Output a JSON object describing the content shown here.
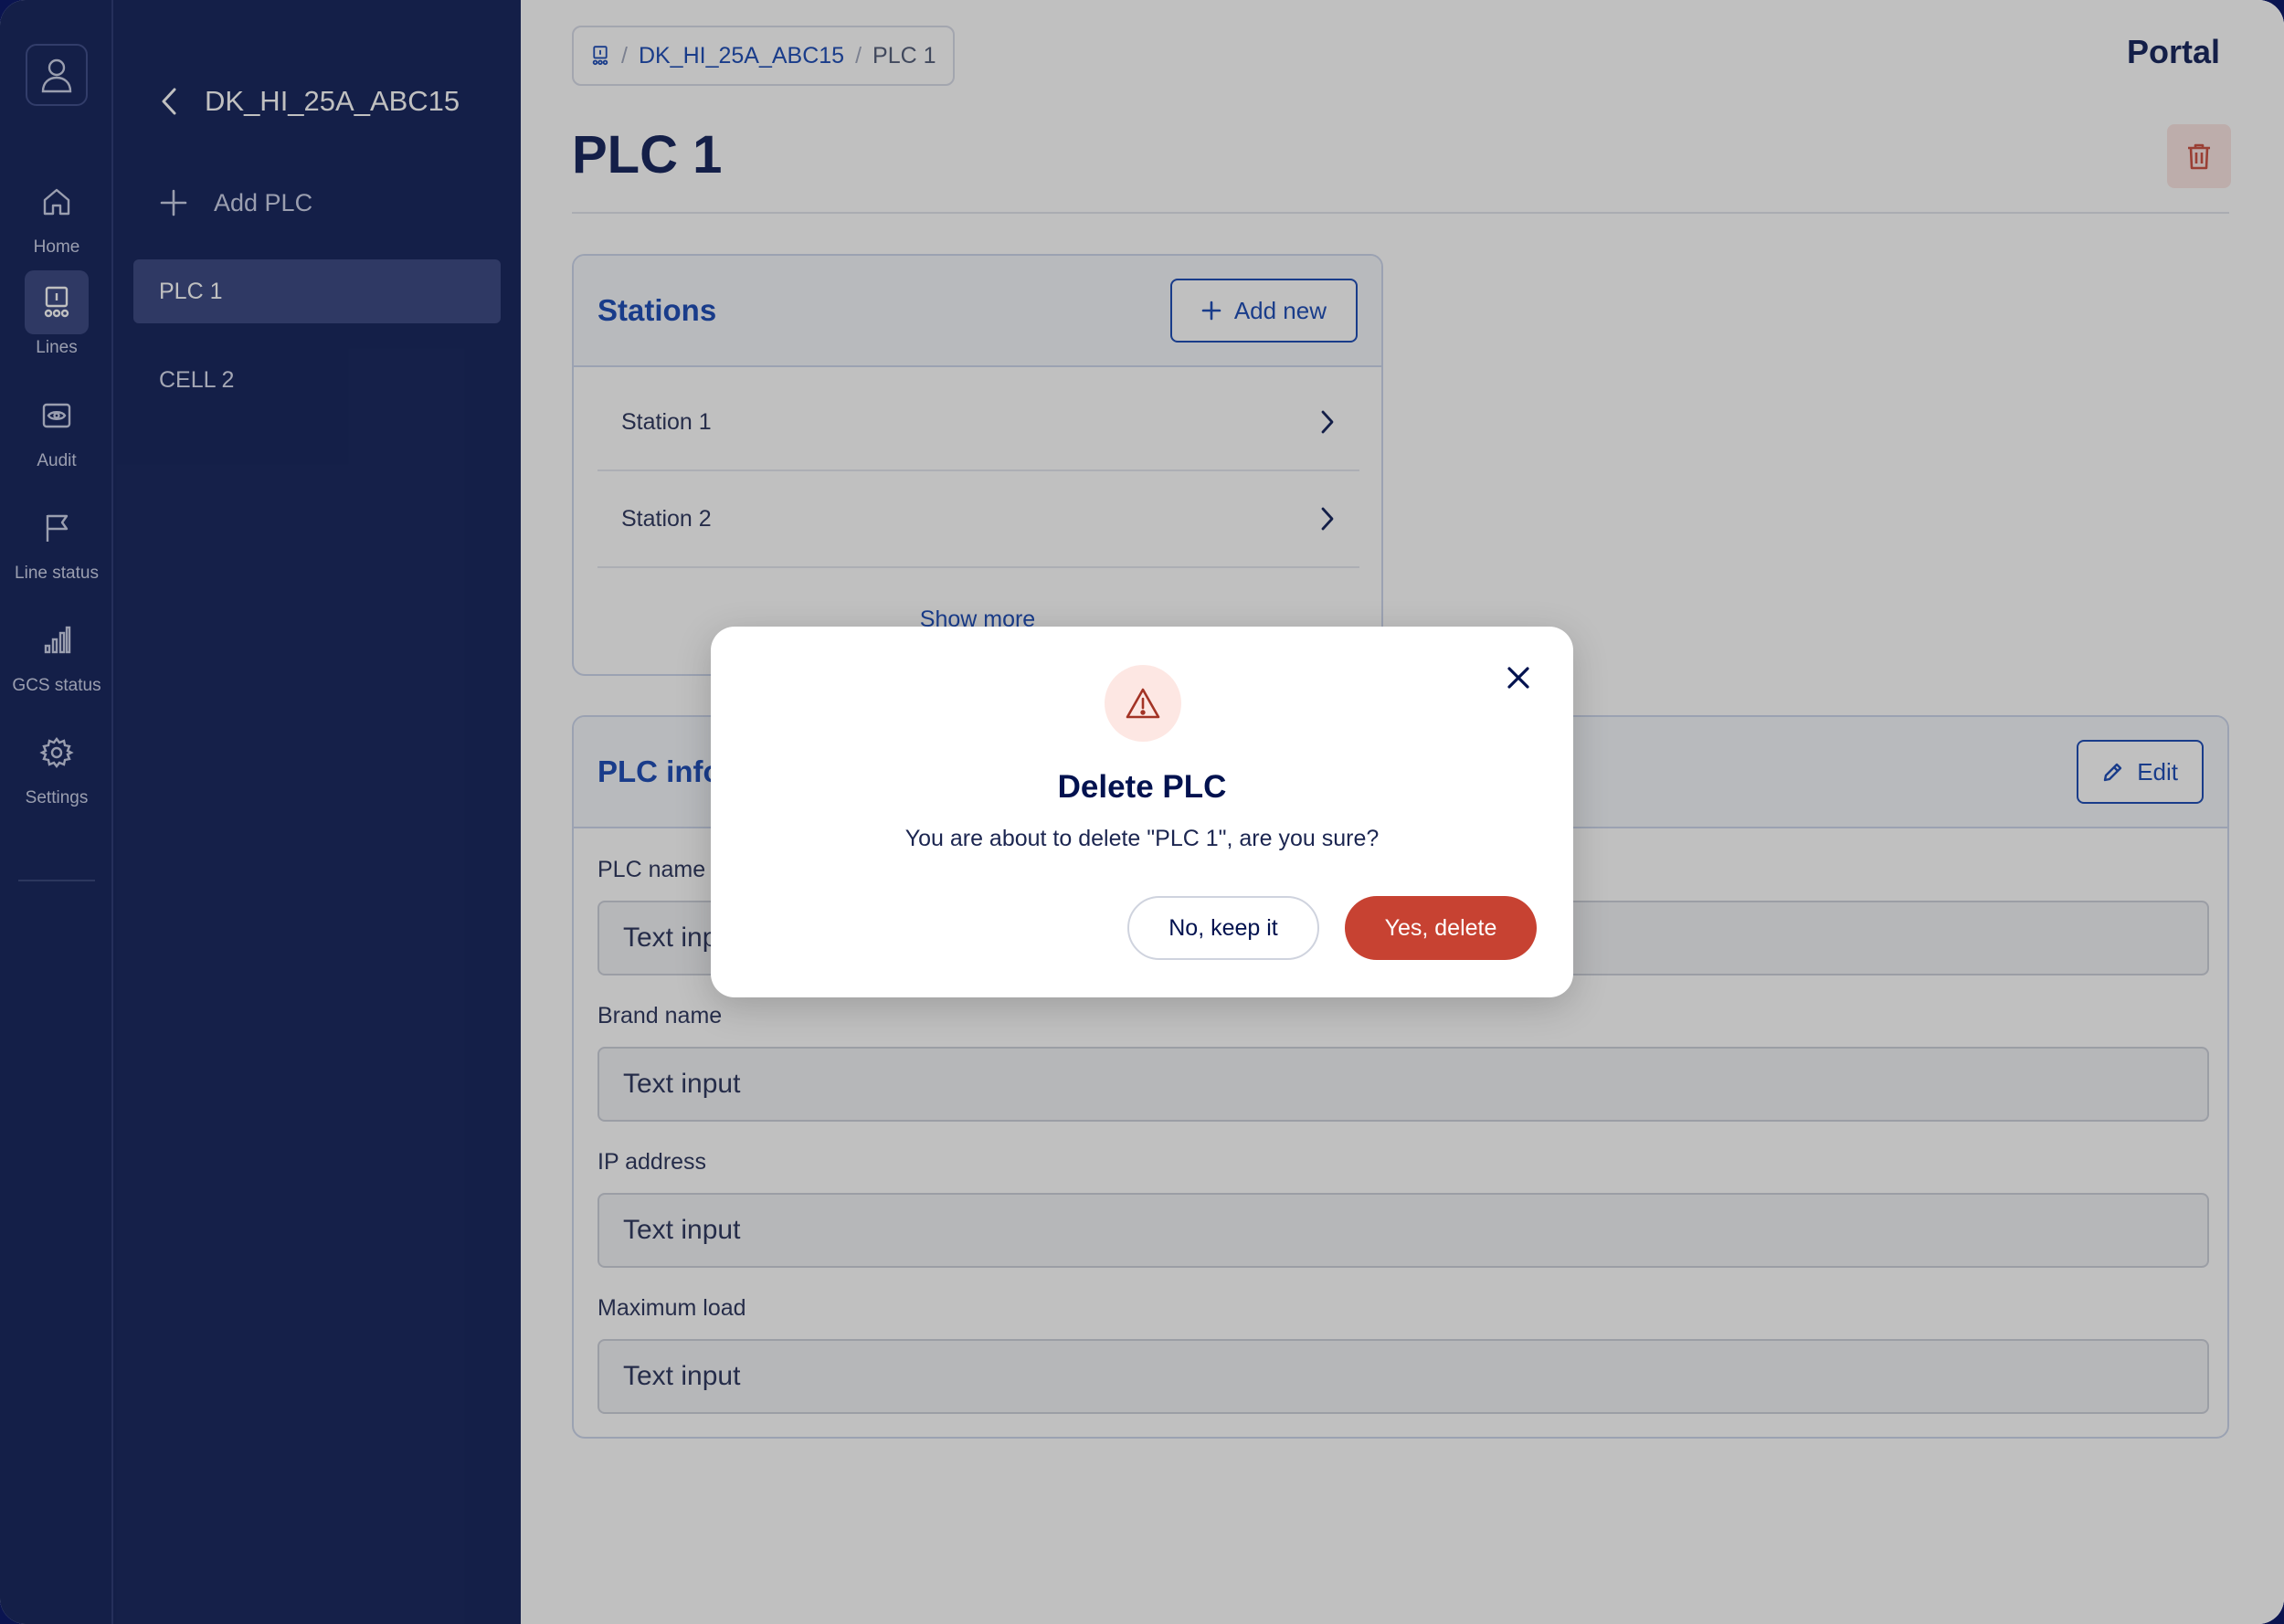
{
  "app": {
    "brand": "Portal"
  },
  "rail": {
    "items": [
      {
        "label": "Home",
        "icon": "home-icon"
      },
      {
        "label": "Lines",
        "icon": "lines-icon",
        "active": true
      },
      {
        "label": "Audit",
        "icon": "eye-icon"
      },
      {
        "label": "Line status",
        "icon": "flag-icon"
      },
      {
        "label": "GCS status",
        "icon": "bar-chart-icon"
      },
      {
        "label": "Settings",
        "icon": "gear-icon"
      }
    ]
  },
  "panel": {
    "title": "DK_HI_25A_ABC15",
    "add_label": "Add PLC",
    "items": [
      {
        "label": "PLC 1",
        "active": true
      },
      {
        "label": "CELL 2"
      }
    ]
  },
  "breadcrumb": {
    "parent": "DK_HI_25A_ABC15",
    "current": "PLC 1"
  },
  "page": {
    "title": "PLC 1"
  },
  "stations": {
    "title": "Stations",
    "add_label": "Add new",
    "rows": [
      "Station 1",
      "Station 2"
    ],
    "show_more": "Show more"
  },
  "plc_info": {
    "title": "PLC info",
    "edit_label": "Edit",
    "fields": [
      {
        "label": "PLC name",
        "value": "Text input"
      },
      {
        "label": "Brand name",
        "value": "Text input"
      },
      {
        "label": "IP address",
        "value": "Text input"
      },
      {
        "label": "Maximum load",
        "value": "Text input"
      }
    ]
  },
  "modal": {
    "title": "Delete PLC",
    "message": "You are about to delete \"PLC 1\", are you sure?",
    "cancel_label": "No, keep it",
    "confirm_label": "Yes, delete",
    "confirm_color": "#c74232"
  },
  "colors": {
    "navy": "#02124f",
    "accent": "#0a3db0",
    "danger": "#c74232"
  }
}
